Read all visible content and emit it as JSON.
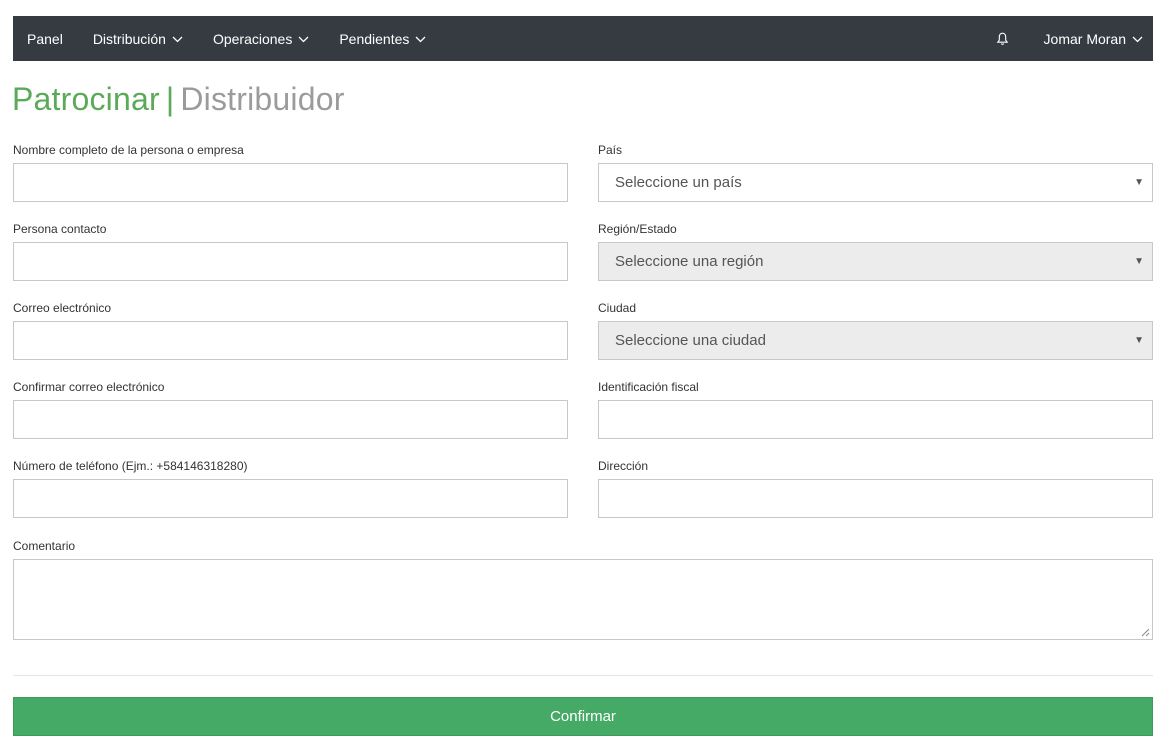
{
  "navbar": {
    "items": [
      {
        "label": "Panel"
      },
      {
        "label": "Distribución"
      },
      {
        "label": "Operaciones"
      },
      {
        "label": "Pendientes"
      }
    ],
    "user_name": "Jomar Moran"
  },
  "header": {
    "title_primary": "Patrocinar",
    "title_separator": "|",
    "title_secondary": "Distribuidor"
  },
  "form": {
    "full_name_label": "Nombre completo de la persona o empresa",
    "contact_label": "Persona contacto",
    "email_label": "Correo electrónico",
    "confirm_email_label": "Confirmar correo electrónico",
    "phone_label": "Número de teléfono (Ejm.: +584146318280)",
    "country_label": "País",
    "country_value": "Seleccione un país",
    "region_label": "Región/Estado",
    "region_value": "Seleccione una región",
    "city_label": "Ciudad",
    "city_value": "Seleccione una ciudad",
    "tax_id_label": "Identificación fiscal",
    "address_label": "Dirección",
    "comment_label": "Comentario",
    "confirm_button": "Confirmar"
  },
  "colors": {
    "navbar_bg": "#363b42",
    "title_green": "#5aaa58",
    "title_gray": "#9b9b9b",
    "button_green": "#45aa66"
  }
}
